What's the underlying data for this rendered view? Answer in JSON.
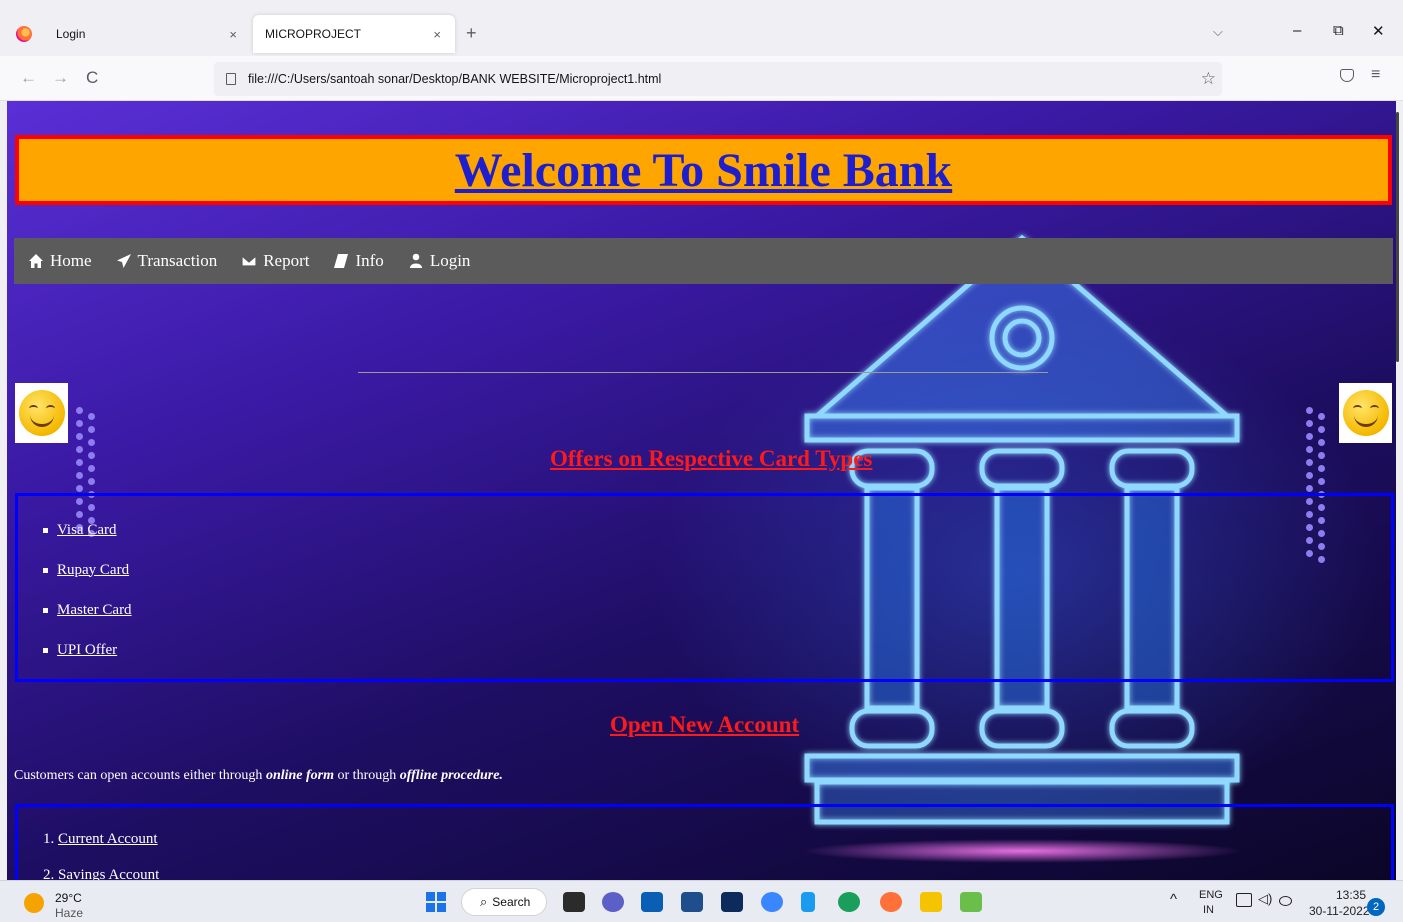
{
  "browser": {
    "tabs": [
      {
        "title": "Login",
        "close": "×"
      },
      {
        "title": "MICROPROJECT",
        "close": "×"
      }
    ],
    "new_tab": "+",
    "tab_list": "⌵",
    "window": {
      "minimize": "–",
      "restore": "⧉",
      "close": "✕"
    },
    "nav": {
      "back": "←",
      "forward": "→",
      "reload": "C",
      "menu": "≡",
      "star": "☆"
    },
    "url": "file:///C:/Users/santoah sonar/Desktop/BANK WEBSITE/Microproject1.html"
  },
  "page": {
    "title": "Welcome To Smile Bank",
    "menu": [
      {
        "label": "Home",
        "icon": "home-icon"
      },
      {
        "label": "Transaction",
        "icon": "paper-plane-icon"
      },
      {
        "label": "Report",
        "icon": "envelope-icon"
      },
      {
        "label": "Info",
        "icon": "book-icon"
      },
      {
        "label": "Login",
        "icon": "user-icon"
      }
    ],
    "offers_heading": "Offers on Respective Card Types",
    "cards": [
      "Visa Card",
      "Rupay Card",
      "Master Card",
      "UPI Offer"
    ],
    "open_account_heading": "Open New Account",
    "customers_text": {
      "before": "Customers can open accounts either through ",
      "online": "online form",
      "middle": " or through ",
      "offline": "offline procedure."
    },
    "accounts": [
      {
        "num": "1. ",
        "label": "Current Account"
      },
      {
        "num": "2. ",
        "label": "Savings Account"
      }
    ],
    "colors": {
      "banner_bg": "#ffa500",
      "banner_border": "#ff0000",
      "title": "#1e1ecc",
      "heading": "#ff1a1a",
      "box_border": "#0000ff",
      "nav_bg": "#5b5b5b"
    }
  },
  "taskbar": {
    "weather_temp": "29°C",
    "weather_desc": "Haze",
    "search": "Search",
    "chevron": "^",
    "lang_top": "ENG",
    "lang_bottom": "IN",
    "time": "13:35",
    "date": "30-11-2022",
    "notifications": "2"
  }
}
